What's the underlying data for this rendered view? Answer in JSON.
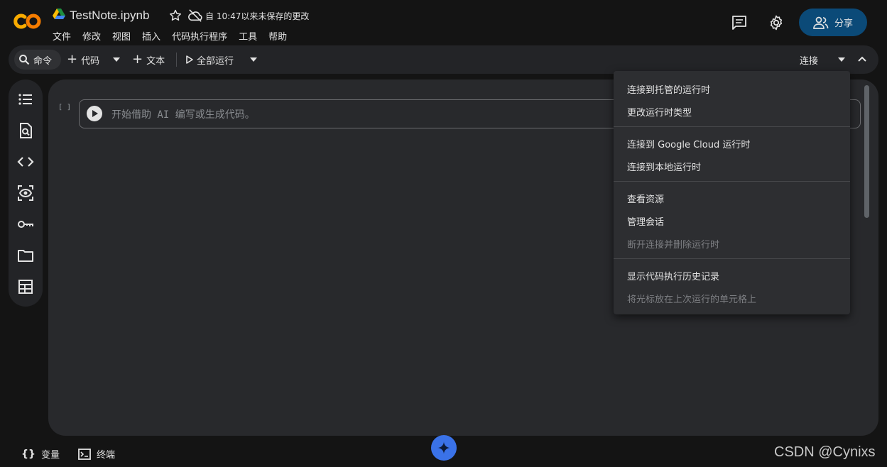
{
  "header": {
    "title": "TestNote.ipynb",
    "save_status": "自 10:47以来未保存的更改",
    "menu": [
      "文件",
      "修改",
      "视图",
      "插入",
      "代码执行程序",
      "工具",
      "帮助"
    ],
    "share_label": "分享"
  },
  "toolbar": {
    "command_label": "命令",
    "code_label": "代码",
    "text_label": "文本",
    "run_all_label": "全部运行",
    "connect_label": "连接"
  },
  "sidebar": {
    "items": [
      "toc-icon",
      "find-icon",
      "code-snippets-icon",
      "variable-inspector-icon",
      "secrets-key-icon",
      "folder-icon",
      "table-icon"
    ]
  },
  "cell": {
    "bracket": "[ ]",
    "placeholder": "开始借助 AI 编写或生成代码。"
  },
  "dropdown": {
    "items": [
      {
        "label": "连接到托管的运行时",
        "disabled": false
      },
      {
        "label": "更改运行时类型",
        "disabled": false
      },
      {
        "label": "连接到 Google Cloud 运行时",
        "disabled": false
      },
      {
        "label": "连接到本地运行时",
        "disabled": false
      },
      {
        "label": "查看资源",
        "disabled": false
      },
      {
        "label": "管理会话",
        "disabled": false
      },
      {
        "label": "断开连接并删除运行时",
        "disabled": true
      },
      {
        "label": "显示代码执行历史记录",
        "disabled": false
      },
      {
        "label": "将光标放在上次运行的单元格上",
        "disabled": true
      }
    ]
  },
  "bottom": {
    "variables_label": "变量",
    "terminal_label": "终端"
  },
  "watermark": "CSDN @Cynixs",
  "colors": {
    "background": "#141414",
    "panel": "#28292c",
    "toolbar": "#232427",
    "share_button": "#0b4a78",
    "logo_orange": "#f9ab00",
    "gemini_blue": "#3a72e8"
  }
}
